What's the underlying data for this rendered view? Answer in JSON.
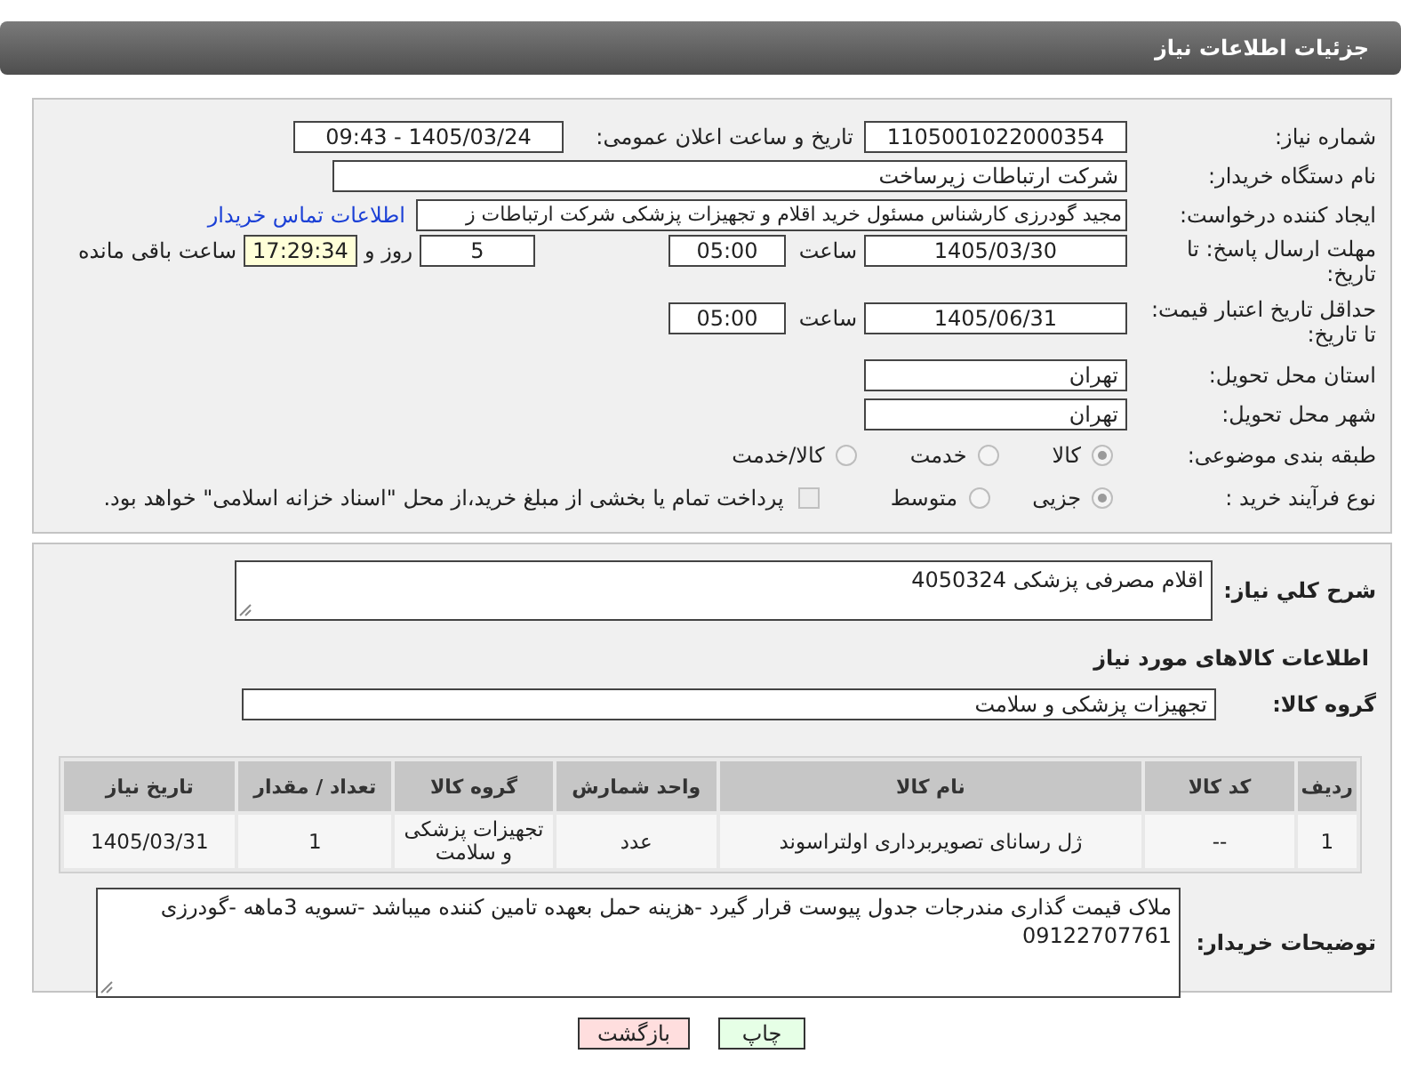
{
  "header": {
    "title": "جزئیات اطلاعات نیاز"
  },
  "need_number": {
    "label": "شماره نیاز:",
    "value": "1105001022000354"
  },
  "announce": {
    "label": "تاریخ و ساعت اعلان عمومی:",
    "value": "1405/03/24 - 09:43"
  },
  "buyer_org": {
    "label": "نام دستگاه خریدار:",
    "value": "شرکت ارتباطات زیرساخت"
  },
  "creator": {
    "label": "ایجاد کننده درخواست:",
    "value": "مجید گودرزی کارشناس مسئول خرید اقلام و تجهیزات پزشکی شرکت ارتباطات ز",
    "link": "اطلاعات تماس خریدار"
  },
  "deadline": {
    "label": "مهلت ارسال پاسخ: تا تاریخ:",
    "date": "1405/03/30",
    "time_label": "ساعت",
    "time": "05:00",
    "days": "5",
    "days_label": "روز و",
    "remaining": "17:29:34",
    "remaining_label": "ساعت باقی مانده"
  },
  "validity": {
    "label": "حداقل تاریخ اعتبار قیمت: تا تاریخ:",
    "date": "1405/06/31",
    "time_label": "ساعت",
    "time": "05:00"
  },
  "province": {
    "label": "استان محل تحویل:",
    "value": "تهران"
  },
  "city": {
    "label": "شهر محل تحویل:",
    "value": "تهران"
  },
  "category": {
    "label": "طبقه بندی موضوعی:",
    "options": [
      {
        "label": "کالا",
        "selected": true
      },
      {
        "label": "خدمت",
        "selected": false
      },
      {
        "label": "کالا/خدمت",
        "selected": false
      }
    ]
  },
  "process": {
    "label": "نوع فرآیند خرید :",
    "options": [
      {
        "label": "جزیی",
        "selected": true
      },
      {
        "label": "متوسط",
        "selected": false
      }
    ],
    "payment": {
      "label": "پرداخت تمام یا بخشی از مبلغ خرید،از محل \"اسناد خزانه اسلامی\" خواهد بود.",
      "checked": false
    }
  },
  "summary": {
    "label": "شرح كلي نیاز:",
    "value": "اقلام مصرفی پزشکی 4050324"
  },
  "items_title": "اطلاعات کالاهای مورد نیاز",
  "goods_group": {
    "label": "گروه کالا:",
    "value": "تجهیزات پزشکی و سلامت"
  },
  "table": {
    "columns": [
      "ردیف",
      "کد کالا",
      "نام کالا",
      "واحد شمارش",
      "گروه کالا",
      "تعداد / مقدار",
      "تاریخ نیاز"
    ],
    "rows": [
      [
        "1",
        "--",
        "ژل رسانای تصویربرداری اولتراسوند",
        "عدد",
        "تجهیزات پزشکی و سلامت",
        "1",
        "1405/03/31"
      ]
    ]
  },
  "notes": {
    "label": "توضیحات خریدار:",
    "value": "ملاک قیمت گذاری مندرجات جدول پیوست قرار گیرد -هزینه حمل بعهده تامین کننده میباشد -تسویه 3ماهه -گودرزی 09122707761"
  },
  "buttons": [
    {
      "label": "چاپ",
      "kind": "print"
    },
    {
      "label": "بازگشت",
      "kind": "back"
    }
  ]
}
